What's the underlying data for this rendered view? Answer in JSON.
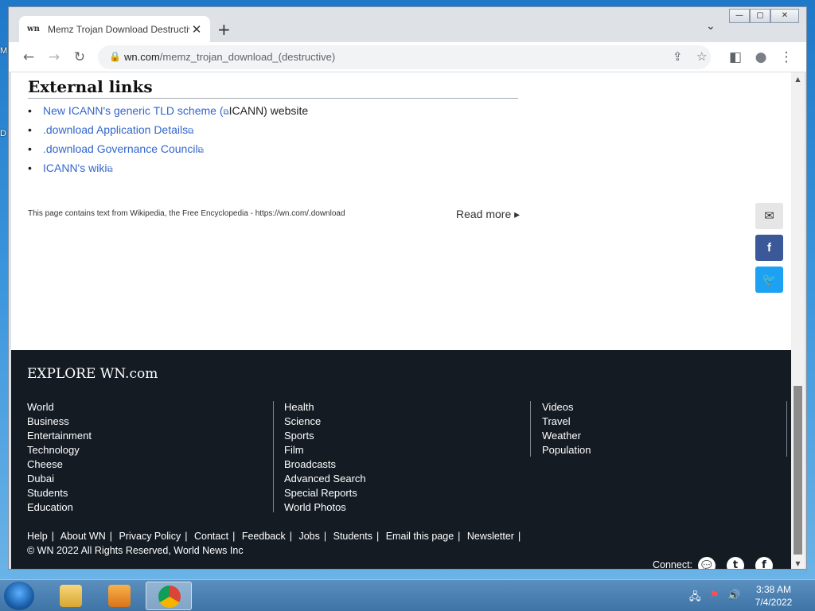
{
  "desktop": {
    "left_labels": [
      "M",
      "D"
    ]
  },
  "browser": {
    "tab": {
      "favicon": "wn",
      "title": "Memz Trojan Download Destructive",
      "close": "✕"
    },
    "new_tab": "+",
    "tab_menu": "⌄",
    "window_controls": {
      "minimize": "—",
      "maximize": "▢",
      "close": "✕"
    },
    "nav": {
      "back": "←",
      "forward": "→",
      "reload": "↻"
    },
    "url_host": "wn.com",
    "url_path": "/memz_trojan_download_(destructive)",
    "lock_icon": "🔒",
    "omni_icons": {
      "share": "⇪",
      "bookmark": "☆",
      "sidepanel": "◧",
      "profile": "●",
      "menu": "⋮"
    }
  },
  "page": {
    "external_links_heading": "External links",
    "external_links": [
      {
        "link": "New ICANN's generic TLD scheme (",
        "icon": "⧉",
        "rest": "ICANN) website"
      },
      {
        "link": ".download Application Details",
        "icon": "⧉",
        "rest": ""
      },
      {
        "link": ".download Governance Council",
        "icon": "⧉",
        "rest": ""
      },
      {
        "link": "ICANN's wiki",
        "icon": "⧉",
        "rest": ""
      }
    ],
    "attribution": "This page contains text from Wikipedia, the Free Encyclopedia - https://wn.com/.download",
    "read_more": "Read more ▸",
    "share": {
      "email": "✉",
      "facebook": "f",
      "twitter": "🐦"
    },
    "colors": {
      "facebook": "#3b5998",
      "twitter": "#1da1f2",
      "email": "#e6e6e6",
      "footer_bg": "#141b23"
    }
  },
  "footer": {
    "title": "EXPLORE WN.com",
    "col1": [
      "World",
      "Business",
      "Entertainment",
      "Technology",
      "Cheese",
      "Dubai",
      "Students",
      "Education"
    ],
    "col2": [
      "Health",
      "Science",
      "Sports",
      "Film",
      "Broadcasts",
      "Advanced Search",
      "Special Reports",
      "World Photos"
    ],
    "col3": [
      "Videos",
      "Travel",
      "Weather",
      "Population"
    ],
    "links": [
      "Help",
      "About WN",
      "Privacy Policy",
      "Contact",
      "Feedback",
      "Jobs",
      "Students",
      "Email this page",
      "Newsletter"
    ],
    "copyright": "© WN 2022 All Rights Reserved, World News Inc",
    "connect": "Connect:",
    "social": {
      "chat": "💬",
      "twitter": "t",
      "facebook": "f"
    }
  },
  "scrollbar": {
    "up": "▲",
    "down": "▼"
  },
  "taskbar": {
    "time": "3:38 AM",
    "date": "7/4/2022",
    "tray": {
      "network": "🖧",
      "flag": "⚑",
      "volume": "🔊"
    }
  }
}
